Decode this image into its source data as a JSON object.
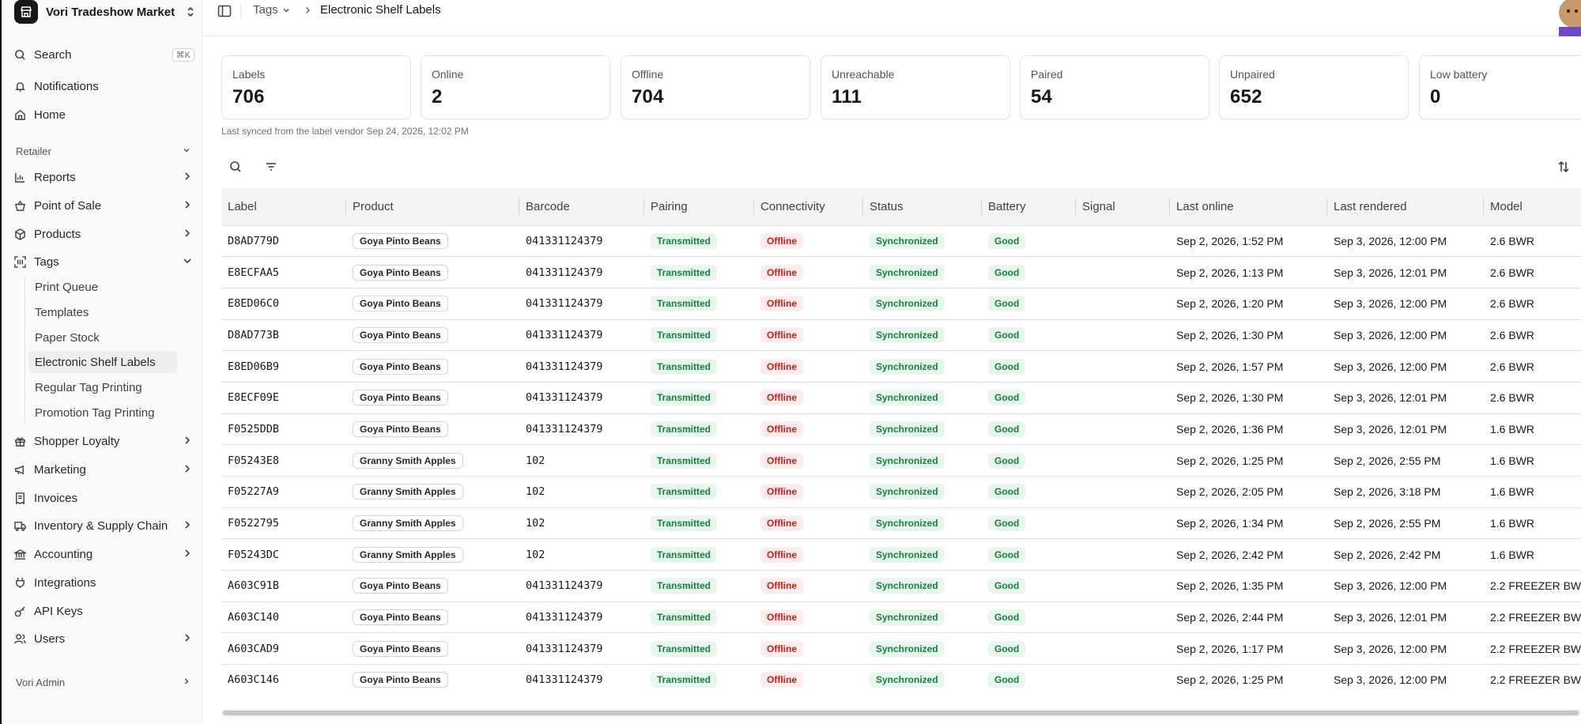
{
  "sidebar": {
    "store_name": "Vori Tradeshow Market",
    "search_label": "Search",
    "search_shortcut": "⌘K",
    "notifications": "Notifications",
    "home": "Home",
    "group_retailer": "Retailer",
    "reports": "Reports",
    "point_of_sale": "Point of Sale",
    "products": "Products",
    "tags": "Tags",
    "tags_sub": [
      "Print Queue",
      "Templates",
      "Paper Stock",
      "Electronic Shelf Labels",
      "Regular Tag Printing",
      "Promotion Tag Printing"
    ],
    "shopper_loyalty": "Shopper Loyalty",
    "marketing": "Marketing",
    "invoices": "Invoices",
    "inventory": "Inventory & Supply Chain",
    "accounting": "Accounting",
    "integrations": "Integrations",
    "api_keys": "API Keys",
    "users": "Users",
    "group_admin": "Vori Admin"
  },
  "breadcrumb": {
    "parent": "Tags",
    "current": "Electronic Shelf Labels"
  },
  "stats": [
    {
      "label": "Labels",
      "value": "706"
    },
    {
      "label": "Online",
      "value": "2"
    },
    {
      "label": "Offline",
      "value": "704"
    },
    {
      "label": "Unreachable",
      "value": "111"
    },
    {
      "label": "Paired",
      "value": "54"
    },
    {
      "label": "Unpaired",
      "value": "652"
    },
    {
      "label": "Low battery",
      "value": "0"
    }
  ],
  "sync_text": "Last synced from the label vendor Sep 24, 2026, 12:02 PM",
  "table": {
    "columns": [
      "Label",
      "Product",
      "Barcode",
      "Pairing",
      "Connectivity",
      "Status",
      "Battery",
      "Signal",
      "Last online",
      "Last rendered",
      "Model"
    ],
    "rows": [
      [
        "D8AD779D",
        "Goya Pinto Beans",
        "041331124379",
        "Transmitted",
        "Offline",
        "Synchronized",
        "Good",
        "",
        "Sep 2, 2026, 1:52 PM",
        "Sep 3, 2026, 12:00 PM",
        "2.6 BWR"
      ],
      [
        "E8ECFAA5",
        "Goya Pinto Beans",
        "041331124379",
        "Transmitted",
        "Offline",
        "Synchronized",
        "Good",
        "",
        "Sep 2, 2026, 1:13 PM",
        "Sep 3, 2026, 12:01 PM",
        "2.6 BWR"
      ],
      [
        "E8ED06C0",
        "Goya Pinto Beans",
        "041331124379",
        "Transmitted",
        "Offline",
        "Synchronized",
        "Good",
        "",
        "Sep 2, 2026, 1:20 PM",
        "Sep 3, 2026, 12:00 PM",
        "2.6 BWR"
      ],
      [
        "D8AD773B",
        "Goya Pinto Beans",
        "041331124379",
        "Transmitted",
        "Offline",
        "Synchronized",
        "Good",
        "",
        "Sep 2, 2026, 1:30 PM",
        "Sep 3, 2026, 12:00 PM",
        "2.6 BWR"
      ],
      [
        "E8ED06B9",
        "Goya Pinto Beans",
        "041331124379",
        "Transmitted",
        "Offline",
        "Synchronized",
        "Good",
        "",
        "Sep 2, 2026, 1:57 PM",
        "Sep 3, 2026, 12:00 PM",
        "2.6 BWR"
      ],
      [
        "E8ECF09E",
        "Goya Pinto Beans",
        "041331124379",
        "Transmitted",
        "Offline",
        "Synchronized",
        "Good",
        "",
        "Sep 2, 2026, 1:30 PM",
        "Sep 3, 2026, 12:01 PM",
        "2.6 BWR"
      ],
      [
        "F0525DDB",
        "Goya Pinto Beans",
        "041331124379",
        "Transmitted",
        "Offline",
        "Synchronized",
        "Good",
        "",
        "Sep 2, 2026, 1:36 PM",
        "Sep 3, 2026, 12:01 PM",
        "1.6 BWR"
      ],
      [
        "F05243E8",
        "Granny Smith Apples",
        "102",
        "Transmitted",
        "Offline",
        "Synchronized",
        "Good",
        "",
        "Sep 2, 2026, 1:25 PM",
        "Sep 2, 2026, 2:55 PM",
        "1.6 BWR"
      ],
      [
        "F05227A9",
        "Granny Smith Apples",
        "102",
        "Transmitted",
        "Offline",
        "Synchronized",
        "Good",
        "",
        "Sep 2, 2026, 2:05 PM",
        "Sep 2, 2026, 3:18 PM",
        "1.6 BWR"
      ],
      [
        "F0522795",
        "Granny Smith Apples",
        "102",
        "Transmitted",
        "Offline",
        "Synchronized",
        "Good",
        "",
        "Sep 2, 2026, 1:34 PM",
        "Sep 2, 2026, 2:55 PM",
        "1.6 BWR"
      ],
      [
        "F05243DC",
        "Granny Smith Apples",
        "102",
        "Transmitted",
        "Offline",
        "Synchronized",
        "Good",
        "",
        "Sep 2, 2026, 2:42 PM",
        "Sep 2, 2026, 2:42 PM",
        "1.6 BWR"
      ],
      [
        "A603C91B",
        "Goya Pinto Beans",
        "041331124379",
        "Transmitted",
        "Offline",
        "Synchronized",
        "Good",
        "",
        "Sep 2, 2026, 1:35 PM",
        "Sep 3, 2026, 12:00 PM",
        "2.2 FREEZER BW"
      ],
      [
        "A603C140",
        "Goya Pinto Beans",
        "041331124379",
        "Transmitted",
        "Offline",
        "Synchronized",
        "Good",
        "",
        "Sep 2, 2026, 2:44 PM",
        "Sep 3, 2026, 12:01 PM",
        "2.2 FREEZER BW"
      ],
      [
        "A603CAD9",
        "Goya Pinto Beans",
        "041331124379",
        "Transmitted",
        "Offline",
        "Synchronized",
        "Good",
        "",
        "Sep 2, 2026, 1:17 PM",
        "Sep 3, 2026, 12:00 PM",
        "2.2 FREEZER BW"
      ],
      [
        "A603C146",
        "Goya Pinto Beans",
        "041331124379",
        "Transmitted",
        "Offline",
        "Synchronized",
        "Good",
        "",
        "Sep 2, 2026, 1:25 PM",
        "Sep 3, 2026, 12:00 PM",
        "2.2 FREEZER BW"
      ]
    ]
  },
  "colors": {
    "green_badge_bg": "#e8f7ee",
    "green_badge_text": "#15803d",
    "red_badge_bg": "#fdecec",
    "red_badge_text": "#c81e1e"
  },
  "icons": [
    "store-icon",
    "search-icon",
    "bell-icon",
    "home-icon",
    "chart-icon",
    "basket-icon",
    "box-icon",
    "scan-icon",
    "gift-icon",
    "megaphone-icon",
    "receipt-icon",
    "truck-icon",
    "bank-icon",
    "plug-icon",
    "key-icon",
    "users-icon",
    "filter-icon",
    "sort-icon",
    "sidebar-toggle-icon"
  ]
}
